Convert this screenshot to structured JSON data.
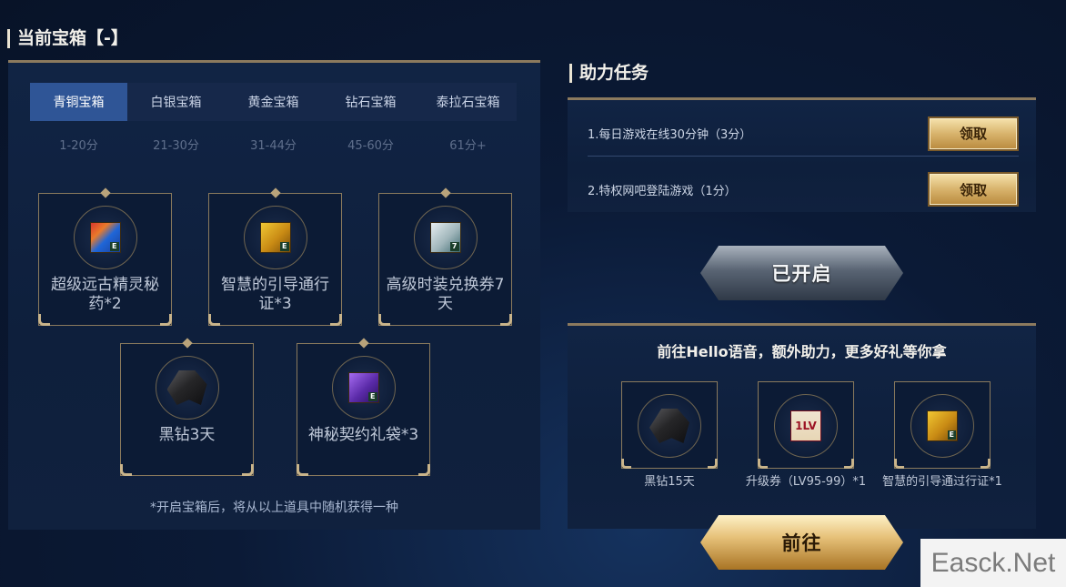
{
  "left": {
    "title": "当前宝箱【-】",
    "tabs": [
      "青铜宝箱",
      "白银宝箱",
      "黄金宝箱",
      "钻石宝箱",
      "泰拉石宝箱"
    ],
    "active_tab": 0,
    "ranges": [
      "1-20分",
      "21-30分",
      "31-44分",
      "45-60分",
      "61分+"
    ],
    "rewards": [
      {
        "label": "超级远古精灵秘药*2",
        "icon": "potion-icon",
        "badge": "E"
      },
      {
        "label": "智慧的引导通行证*3",
        "icon": "pass-icon",
        "badge": "E"
      },
      {
        "label": "高级时装兑换券7天",
        "icon": "voucher-icon",
        "badge": "7"
      },
      {
        "label": "黑钻3天",
        "icon": "black-diamond-icon"
      },
      {
        "label": "神秘契约礼袋*3",
        "icon": "bag-icon",
        "badge": "E"
      }
    ],
    "note": "*开启宝箱后，将从以上道具中随机获得一种"
  },
  "tasks": {
    "title": "助力任务",
    "items": [
      {
        "text": "1.每日游戏在线30分钟（3分）",
        "button": "领取"
      },
      {
        "text": "2.特权网吧登陆游戏（1分）",
        "button": "领取"
      }
    ]
  },
  "opened_button": "已开启",
  "hello": {
    "title": "前往Hello语音，额外助力，更多好礼等你拿",
    "items": [
      {
        "label": "黑钻15天",
        "icon": "black-diamond-icon"
      },
      {
        "label": "升级券（LV95-99）*1",
        "icon": "level-ticket-icon",
        "pic_text": "1LV"
      },
      {
        "label": "智慧的引导通过行证*1",
        "icon": "pass-icon",
        "badge": "E"
      }
    ],
    "button": "前往"
  },
  "watermark": "Easck.Net",
  "colors": {
    "accent": "#2f5596",
    "gold": "#d8b36c",
    "panel": "#112444"
  }
}
